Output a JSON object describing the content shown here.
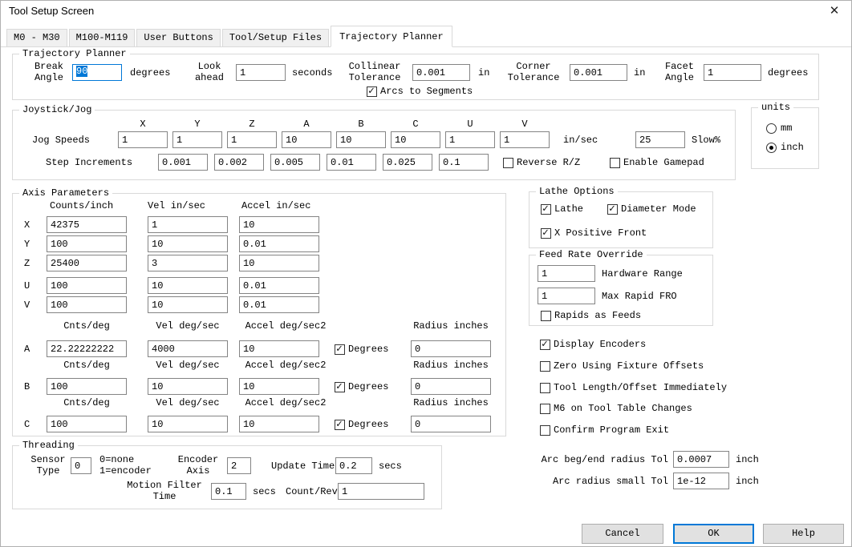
{
  "window": {
    "title": "Tool Setup Screen",
    "close_icon": "✕"
  },
  "tabs": [
    {
      "label": "M0 - M30"
    },
    {
      "label": "M100-M119"
    },
    {
      "label": "User Buttons"
    },
    {
      "label": "Tool/Setup Files"
    },
    {
      "label": "Trajectory Planner"
    }
  ],
  "trajectory_planner": {
    "title": "Trajectory Planner",
    "break_angle": {
      "label": "Break Angle",
      "value": "90",
      "unit": "degrees"
    },
    "look_ahead": {
      "label": "Look ahead",
      "value": "1",
      "unit": "seconds"
    },
    "collinear_tolerance": {
      "label": "Collinear Tolerance",
      "value": "0.001",
      "unit": "in"
    },
    "corner_tolerance": {
      "label": "Corner Tolerance",
      "value": "0.001",
      "unit": "in"
    },
    "facet_angle": {
      "label": "Facet Angle",
      "value": "1",
      "unit": "degrees"
    },
    "arcs_to_segments": {
      "label": "Arcs to Segments",
      "checked": true
    }
  },
  "joystick_jog": {
    "title": "Joystick/Jog",
    "jog_speeds_label": "Jog Speeds",
    "axis_headers": [
      "X",
      "Y",
      "Z",
      "A",
      "B",
      "C",
      "U",
      "V"
    ],
    "jog_speeds": [
      "1",
      "1",
      "1",
      "10",
      "10",
      "10",
      "1",
      "1"
    ],
    "jog_unit": "in/sec",
    "slow_value": "25",
    "slow_label": "Slow%",
    "step_increments_label": "Step Increments",
    "step_increments": [
      "0.001",
      "0.002",
      "0.005",
      "0.01",
      "0.025",
      "0.1"
    ],
    "reverse_rz": {
      "label": "Reverse R/Z",
      "checked": false
    },
    "enable_gamepad": {
      "label": "Enable Gamepad",
      "checked": false
    }
  },
  "units": {
    "title": "units",
    "options": [
      {
        "label": "mm",
        "selected": false
      },
      {
        "label": "inch",
        "selected": true
      }
    ]
  },
  "axis_parameters": {
    "title": "Axis Parameters",
    "linear_headers": [
      "Counts/inch",
      "Vel in/sec",
      "Accel in/sec"
    ],
    "linear_rows": [
      {
        "axis": "X",
        "counts": "42375",
        "vel": "1",
        "accel": "10"
      },
      {
        "axis": "Y",
        "counts": "100",
        "vel": "10",
        "accel": "0.01"
      },
      {
        "axis": "Z",
        "counts": "25400",
        "vel": "3",
        "accel": "10"
      },
      {
        "axis": "U",
        "counts": "100",
        "vel": "10",
        "accel": "0.01"
      },
      {
        "axis": "V",
        "counts": "100",
        "vel": "10",
        "accel": "0.01"
      }
    ],
    "rotary_headers": [
      "Cnts/deg",
      "Vel deg/sec",
      "Accel deg/sec2",
      "Radius inches"
    ],
    "degrees_label": "Degrees",
    "rotary_rows": [
      {
        "axis": "A",
        "cnts": "22.22222222",
        "vel": "4000",
        "accel": "10",
        "degrees_checked": true,
        "radius": "0"
      },
      {
        "axis": "B",
        "cnts": "100",
        "vel": "10",
        "accel": "10",
        "degrees_checked": true,
        "radius": "0"
      },
      {
        "axis": "C",
        "cnts": "100",
        "vel": "10",
        "accel": "10",
        "degrees_checked": true,
        "radius": "0"
      }
    ]
  },
  "lathe_options": {
    "title": "Lathe Options",
    "checkboxes": [
      {
        "label": "Lathe",
        "checked": true
      },
      {
        "label": "Diameter Mode",
        "checked": true
      },
      {
        "label": "X Positive Front",
        "checked": true
      }
    ]
  },
  "feed_rate_override": {
    "title": "Feed Rate Override",
    "hardware_range": {
      "value": "1",
      "label": "Hardware Range"
    },
    "max_rapid_fro": {
      "value": "1",
      "label": "Max Rapid FRO"
    },
    "rapids_as_feeds": {
      "label": "Rapids as Feeds",
      "checked": false
    }
  },
  "option_checkboxes": [
    {
      "label": "Display Encoders",
      "checked": true
    },
    {
      "label": "Zero Using Fixture Offsets",
      "checked": false
    },
    {
      "label": "Tool Length/Offset Immediately",
      "checked": false
    },
    {
      "label": "M6 on Tool Table Changes",
      "checked": false
    },
    {
      "label": "Confirm Program Exit",
      "checked": false
    }
  ],
  "arc_tolerances": {
    "beg_end": {
      "label": "Arc beg/end radius Tol",
      "value": "0.0007",
      "unit": "inch"
    },
    "small": {
      "label": "Arc radius small Tol",
      "value": "1e-12",
      "unit": "inch"
    }
  },
  "threading": {
    "title": "Threading",
    "sensor_type": {
      "label": "Sensor Type",
      "value": "0",
      "note_line1": "0=none",
      "note_line2": "1=encoder"
    },
    "encoder_axis": {
      "label": "Encoder Axis",
      "value": "2"
    },
    "update_time": {
      "label": "Update Time",
      "value": "0.2",
      "unit": "secs"
    },
    "motion_filter_time": {
      "label": "Motion Filter Time",
      "value": "0.1",
      "unit": "secs"
    },
    "count_rev": {
      "label": "Count/Rev",
      "value": "1"
    }
  },
  "buttons": [
    {
      "label": "Cancel"
    },
    {
      "label": "OK"
    },
    {
      "label": "Help"
    }
  ]
}
